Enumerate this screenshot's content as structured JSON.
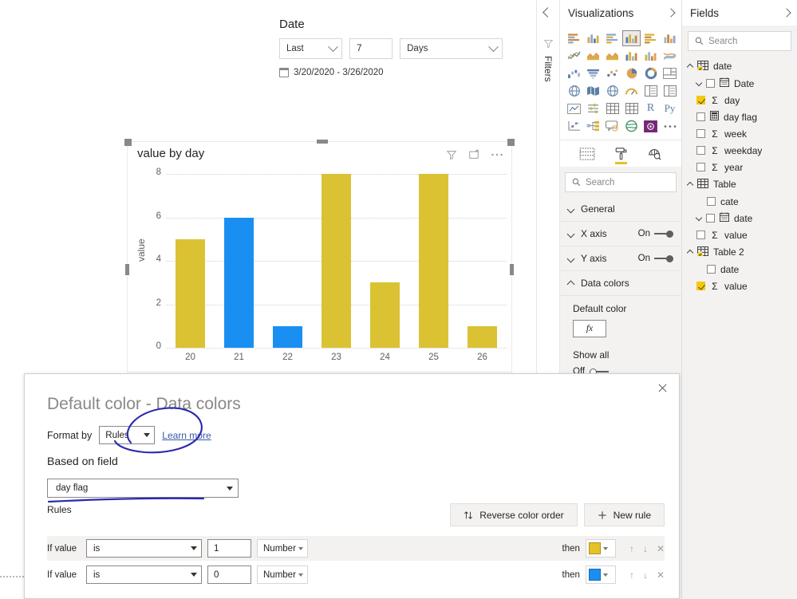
{
  "slicer": {
    "title": "Date",
    "mode": "Last",
    "count": "7",
    "unit": "Days",
    "range": "3/20/2020 - 3/26/2020",
    "calendar_icon": "calendar-icon"
  },
  "chart_data": {
    "type": "bar",
    "title": "value by day",
    "categories": [
      "20",
      "21",
      "22",
      "23",
      "24",
      "25",
      "26"
    ],
    "values": [
      5,
      6,
      1,
      8,
      3,
      8,
      1
    ],
    "colors": [
      "#DBC233",
      "#1A8FF2",
      "#1A8FF2",
      "#DBC233",
      "#DBC233",
      "#DBC233",
      "#DBC233"
    ],
    "xlabel": "",
    "ylabel": "value",
    "ylim": [
      0,
      8
    ],
    "yticks": [
      0,
      2,
      4,
      6,
      8
    ],
    "grid": true,
    "legend": "none",
    "header_icons": [
      "filter-icon",
      "focus-mode-icon",
      "more-options-icon"
    ]
  },
  "filters_rail": {
    "label": "Filters",
    "collapse_icon": "chevron-left-icon",
    "funnel_icon": "filter-funnel-icon"
  },
  "visualizations": {
    "title": "Visualizations",
    "expand_icon": "chevron-right-icon",
    "gallery": [
      "stacked-bar-chart",
      "stacked-column-chart",
      "clustered-bar-chart",
      "clustered-column-chart",
      "100-stacked-bar-chart",
      "100-stacked-column-chart",
      "line-chart",
      "area-chart",
      "stacked-area-chart",
      "line-and-stacked-column-chart",
      "line-and-clustered-column-chart",
      "ribbon-chart",
      "waterfall-chart",
      "funnel-chart",
      "scatter-chart",
      "pie-chart",
      "donut-chart",
      "treemap",
      "map",
      "filled-map",
      "shape-map",
      "gauge",
      "multi-row-card",
      "card",
      "kpi",
      "slicer",
      "table",
      "matrix",
      "r-script-visual",
      "python-visual",
      "key-influencers",
      "decomposition-tree",
      "qna-visual",
      "arcgis-maps",
      "power-apps-visual",
      "more-visuals"
    ],
    "selected_index": 3,
    "tabs": [
      {
        "name": "fields-tab",
        "icon": "fields-table-icon",
        "active": false
      },
      {
        "name": "format-tab",
        "icon": "paint-roller-icon",
        "active": true
      },
      {
        "name": "analytics-tab",
        "icon": "analytics-magnifier-icon",
        "active": false
      }
    ],
    "search_placeholder": "Search",
    "search_icon": "search-icon",
    "format_sections": [
      {
        "label": "General",
        "toggle": null
      },
      {
        "label": "X axis",
        "toggle": "On"
      },
      {
        "label": "Y axis",
        "toggle": "On"
      },
      {
        "label": "Data colors",
        "toggle": null,
        "expanded": true
      }
    ],
    "data_colors": {
      "default_color_label": "Default color",
      "fx_label": "fx",
      "show_all_label": "Show all",
      "show_all_state": "Off"
    }
  },
  "fields": {
    "title": "Fields",
    "expand_icon": "chevron-right-icon",
    "search_placeholder": "Search",
    "search_icon": "search-icon",
    "tables": [
      {
        "name": "date",
        "icon": "table-calculated-icon",
        "expanded": true,
        "items": [
          {
            "label": "Date",
            "icon": "calendar-field-icon",
            "checked": false,
            "has_caret": true,
            "type": "hierarchy"
          },
          {
            "label": "day",
            "icon": "sigma-icon",
            "checked": true,
            "type": "measure"
          },
          {
            "label": "day flag",
            "icon": "calculator-icon",
            "checked": false,
            "type": "calculated"
          },
          {
            "label": "week",
            "icon": "sigma-icon",
            "checked": false,
            "type": "measure"
          },
          {
            "label": "weekday",
            "icon": "sigma-icon",
            "checked": false,
            "type": "measure"
          },
          {
            "label": "year",
            "icon": "sigma-icon",
            "checked": false,
            "type": "measure"
          }
        ]
      },
      {
        "name": "Table",
        "icon": "table-icon",
        "expanded": true,
        "items": [
          {
            "label": "cate",
            "icon": "none",
            "checked": false,
            "type": "column"
          },
          {
            "label": "date",
            "icon": "calendar-field-icon",
            "checked": false,
            "has_caret": true,
            "type": "hierarchy"
          },
          {
            "label": "value",
            "icon": "sigma-icon",
            "checked": false,
            "type": "measure"
          }
        ]
      },
      {
        "name": "Table 2",
        "icon": "table-calculated-icon",
        "expanded": true,
        "items": [
          {
            "label": "date",
            "icon": "none",
            "checked": false,
            "type": "column"
          },
          {
            "label": "value",
            "icon": "sigma-icon",
            "checked": true,
            "type": "measure"
          }
        ]
      }
    ]
  },
  "dialog": {
    "title": "Default color - Data colors",
    "close_icon": "close-icon",
    "format_by_label": "Format by",
    "format_by_value": "Rules",
    "learn_more": "Learn more",
    "based_on_field_label": "Based on field",
    "based_on_field_value": "day flag",
    "rules_label": "Rules",
    "reverse_button": "Reverse color order",
    "reverse_icon": "reverse-order-icon",
    "new_rule_button": "New rule",
    "new_rule_icon": "plus-icon",
    "rules": [
      {
        "if_label": "If value",
        "operator": "is",
        "value": "1",
        "type": "Number",
        "then_label": "then",
        "color": "#E6C229"
      },
      {
        "if_label": "If value",
        "operator": "is",
        "value": "0",
        "type": "Number",
        "then_label": "then",
        "color": "#1A8FF2"
      }
    ],
    "row_actions": [
      "move-up-icon",
      "move-down-icon",
      "delete-rule-icon"
    ]
  }
}
